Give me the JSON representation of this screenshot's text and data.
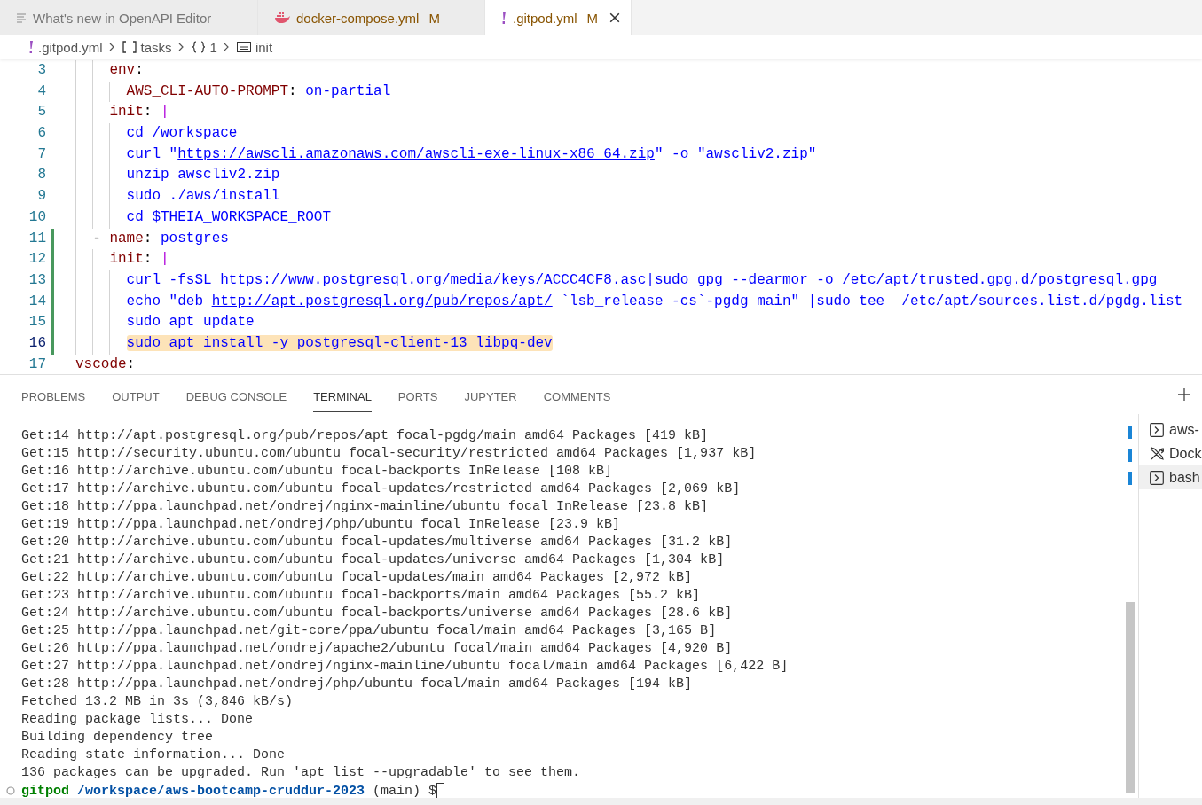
{
  "tabs": [
    {
      "label": "What's new in OpenAPI Editor",
      "kind": "preview",
      "selected": false,
      "modified": false
    },
    {
      "label": "docker-compose.yml",
      "kind": "docker",
      "selected": false,
      "modified": true,
      "badge": "M"
    },
    {
      "label": ".gitpod.yml",
      "kind": "yaml",
      "selected": true,
      "modified": true,
      "badge": "M"
    }
  ],
  "breadcrumbs": [
    {
      "kind": "yaml",
      "label": ".gitpod.yml"
    },
    {
      "kind": "array",
      "label": "tasks"
    },
    {
      "kind": "object",
      "label": "1"
    },
    {
      "kind": "string",
      "label": "init"
    }
  ],
  "editor": {
    "lines": [
      {
        "number": "3",
        "changed": false,
        "highlighted": false,
        "tokens": [
          {
            "kind": "key",
            "text": "    env"
          },
          {
            "kind": "punct",
            "text": ":"
          }
        ]
      },
      {
        "number": "4",
        "changed": false,
        "highlighted": false,
        "tokens": [
          {
            "kind": "key",
            "text": "      AWS_CLI-AUTO-PROMPT"
          },
          {
            "kind": "punct",
            "text": ": "
          },
          {
            "kind": "value",
            "text": "on-partial"
          }
        ]
      },
      {
        "number": "5",
        "changed": false,
        "highlighted": false,
        "tokens": [
          {
            "kind": "key",
            "text": "    init"
          },
          {
            "kind": "punct",
            "text": ": "
          },
          {
            "kind": "block",
            "text": "|"
          }
        ]
      },
      {
        "number": "6",
        "changed": false,
        "highlighted": false,
        "tokens": [
          {
            "kind": "value",
            "text": "      cd /workspace"
          }
        ]
      },
      {
        "number": "7",
        "changed": false,
        "highlighted": false,
        "tokens": [
          {
            "kind": "value",
            "text": "      curl \""
          },
          {
            "kind": "link",
            "text": "https://awscli.amazonaws.com/awscli-exe-linux-x86_64.zip"
          },
          {
            "kind": "value",
            "text": "\" -o \"awscliv2.zip\""
          }
        ]
      },
      {
        "number": "8",
        "changed": false,
        "highlighted": false,
        "tokens": [
          {
            "kind": "value",
            "text": "      unzip awscliv2.zip"
          }
        ]
      },
      {
        "number": "9",
        "changed": false,
        "highlighted": false,
        "tokens": [
          {
            "kind": "value",
            "text": "      sudo ./aws/install"
          }
        ]
      },
      {
        "number": "10",
        "changed": false,
        "highlighted": false,
        "tokens": [
          {
            "kind": "value",
            "text": "      cd $THEIA_WORKSPACE_ROOT"
          }
        ]
      },
      {
        "number": "11",
        "changed": true,
        "highlighted": false,
        "tokens": [
          {
            "kind": "punct",
            "text": "  - "
          },
          {
            "kind": "key",
            "text": "name"
          },
          {
            "kind": "punct",
            "text": ": "
          },
          {
            "kind": "value",
            "text": "postgres"
          }
        ]
      },
      {
        "number": "12",
        "changed": true,
        "highlighted": false,
        "tokens": [
          {
            "kind": "key",
            "text": "    init"
          },
          {
            "kind": "punct",
            "text": ": "
          },
          {
            "kind": "block",
            "text": "|"
          }
        ]
      },
      {
        "number": "13",
        "changed": true,
        "highlighted": false,
        "tokens": [
          {
            "kind": "value",
            "text": "      curl -fsSL "
          },
          {
            "kind": "link",
            "text": "https://www.postgresql.org/media/keys/ACCC4CF8.asc|sudo"
          },
          {
            "kind": "value",
            "text": " gpg --dearmor -o /etc/apt/trusted.gpg.d/postgresql.gpg"
          }
        ]
      },
      {
        "number": "14",
        "changed": true,
        "highlighted": false,
        "tokens": [
          {
            "kind": "value",
            "text": "      echo \"deb "
          },
          {
            "kind": "link",
            "text": "http://apt.postgresql.org/pub/repos/apt/"
          },
          {
            "kind": "value",
            "text": " `lsb_release -cs`-pgdg main\" |sudo tee  /etc/apt/sources.list.d/pgdg.list"
          }
        ]
      },
      {
        "number": "15",
        "changed": true,
        "highlighted": false,
        "tokens": [
          {
            "kind": "value",
            "text": "      sudo apt update"
          }
        ]
      },
      {
        "number": "16",
        "changed": true,
        "highlighted": true,
        "tokens": [
          {
            "kind": "value",
            "text": "      sudo apt install -y postgresql-client-13 libpq-dev"
          }
        ]
      },
      {
        "number": "17",
        "changed": false,
        "highlighted": false,
        "tokens": [
          {
            "kind": "key",
            "text": "vscode"
          },
          {
            "kind": "punct",
            "text": ":"
          }
        ]
      }
    ]
  },
  "panel_tabs": [
    {
      "label": "PROBLEMS",
      "selected": false
    },
    {
      "label": "OUTPUT",
      "selected": false
    },
    {
      "label": "DEBUG CONSOLE",
      "selected": false
    },
    {
      "label": "TERMINAL",
      "selected": true
    },
    {
      "label": "PORTS",
      "selected": false
    },
    {
      "label": "JUPYTER",
      "selected": false
    },
    {
      "label": "COMMENTS",
      "selected": false
    }
  ],
  "terminal": {
    "lines": [
      "Get:14 http://apt.postgresql.org/pub/repos/apt focal-pgdg/main amd64 Packages [419 kB]",
      "Get:15 http://security.ubuntu.com/ubuntu focal-security/restricted amd64 Packages [1,937 kB]",
      "Get:16 http://archive.ubuntu.com/ubuntu focal-backports InRelease [108 kB]",
      "Get:17 http://archive.ubuntu.com/ubuntu focal-updates/restricted amd64 Packages [2,069 kB]",
      "Get:18 http://ppa.launchpad.net/ondrej/nginx-mainline/ubuntu focal InRelease [23.8 kB]",
      "Get:19 http://ppa.launchpad.net/ondrej/php/ubuntu focal InRelease [23.9 kB]",
      "Get:20 http://archive.ubuntu.com/ubuntu focal-updates/multiverse amd64 Packages [31.2 kB]",
      "Get:21 http://archive.ubuntu.com/ubuntu focal-updates/universe amd64 Packages [1,304 kB]",
      "Get:22 http://archive.ubuntu.com/ubuntu focal-updates/main amd64 Packages [2,972 kB]",
      "Get:23 http://archive.ubuntu.com/ubuntu focal-backports/main amd64 Packages [55.2 kB]",
      "Get:24 http://archive.ubuntu.com/ubuntu focal-backports/universe amd64 Packages [28.6 kB]",
      "Get:25 http://ppa.launchpad.net/git-core/ppa/ubuntu focal/main amd64 Packages [3,165 B]",
      "Get:26 http://ppa.launchpad.net/ondrej/apache2/ubuntu focal/main amd64 Packages [4,920 B]",
      "Get:27 http://ppa.launchpad.net/ondrej/nginx-mainline/ubuntu focal/main amd64 Packages [6,422 B]",
      "Get:28 http://ppa.launchpad.net/ondrej/php/ubuntu focal/main amd64 Packages [194 kB]",
      "Fetched 13.2 MB in 3s (3,846 kB/s)",
      "Reading package lists... Done",
      "Building dependency tree",
      "Reading state information... Done",
      "136 packages can be upgraded. Run 'apt list --upgradable' to see them."
    ],
    "prompt": {
      "user": "gitpod",
      "path": "/workspace/aws-bootcamp-cruddur-2023",
      "rest": "(main) $"
    }
  },
  "terminal_list": [
    {
      "label": "aws-",
      "kind": "terminal",
      "selected": false
    },
    {
      "label": "Dock",
      "kind": "tasks",
      "selected": false
    },
    {
      "label": "bash",
      "kind": "terminal",
      "selected": true
    }
  ]
}
